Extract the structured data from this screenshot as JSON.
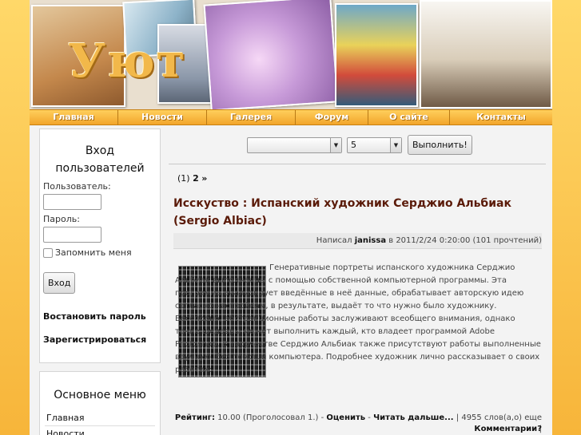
{
  "header": {
    "logo_text": "Уют"
  },
  "nav": {
    "items": [
      "Главная",
      "Новости",
      "Галерея",
      "Форум",
      "О сайте",
      "Контакты"
    ]
  },
  "login": {
    "title": "Вход пользователей",
    "username_label": "Пользователь:",
    "password_label": "Пароль:",
    "remember_label": "Запомнить меня",
    "submit_label": "Вход",
    "restore_link": "Востановить пароль",
    "register_link": "Зарегистрироваться"
  },
  "main_menu": {
    "title": "Основное меню",
    "items": [
      "Главная",
      "Новости"
    ]
  },
  "toolbar": {
    "select1_value": "",
    "select2_value": "5",
    "execute_label": "Выполнить!"
  },
  "pager": {
    "current": "(1)",
    "next_page": "2",
    "next_arrow": "»"
  },
  "article": {
    "title": "Исскуство : Испанский художник Серджио Альбиак (Sergio Albiac)",
    "meta_prefix": "Написал",
    "author": "janissa",
    "meta_suffix": "в 2011/2/24 0:20:00 (101 прочтений)",
    "body": "Генеративные портреты испанского художника Серджио Альбиак выполненны с помощью собственной компьютерной программы. Эта программа анализирует введённые в неё данные, обрабатывает авторскую идею согласно настройкам, в результате, выдаёт то что нужно было художнику. Бесспорно, абстракционные работы заслуживают всеобщего внимания, однако такие шедевры может выполнить каждый, кто владеет программой Adobe Photoshop. В творчестве Серджио Альбиак также присутствуют работы выполненные вручную, без помощи компьютера. Подробнее художник лично рассказывает о своих работах:",
    "rating_label": "Рейтинг:",
    "rating_value": "10.00 (Проголосовал 1.) -",
    "rate_link": "Оценить",
    "read_more": "Читать дальше...",
    "words": "| 4955 слов(а,о) еще |",
    "comments": "Комментарии?"
  },
  "colors": {
    "background": "#fbc84a",
    "title": "#5a1a08",
    "nav": "#f2a52b"
  }
}
